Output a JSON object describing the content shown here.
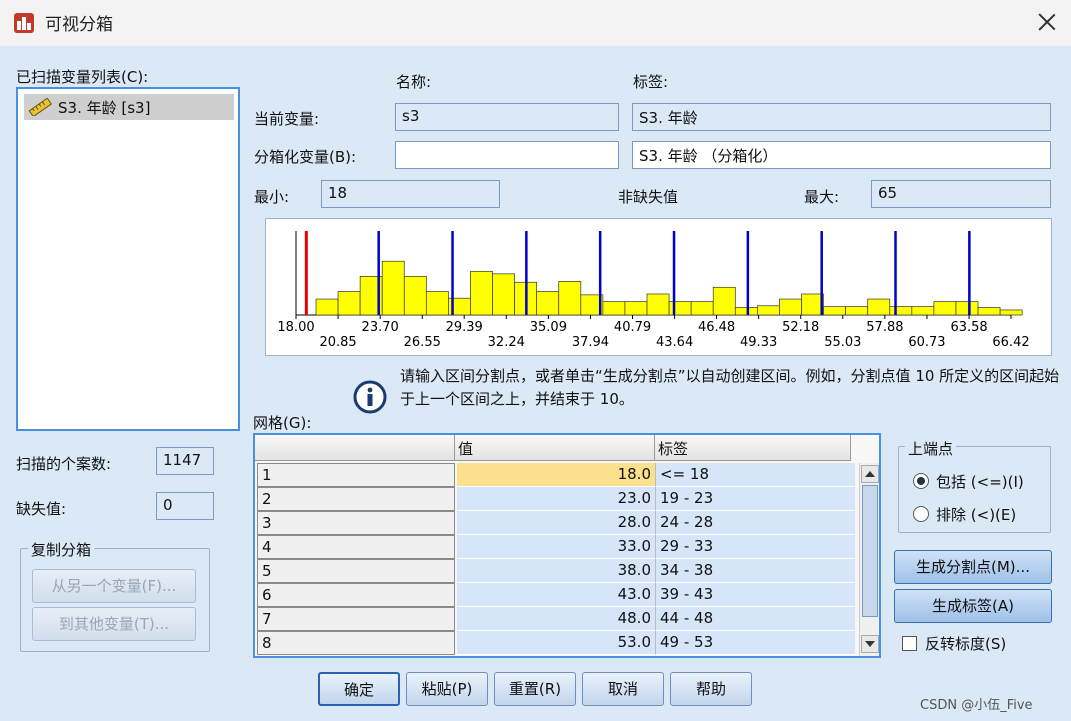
{
  "window": {
    "title": "可视分箱"
  },
  "var_list": {
    "label": "已扫描变量列表(C):",
    "items": [
      "S3. 年龄 [s3]"
    ]
  },
  "headers": {
    "name": "名称:",
    "label": "标签:"
  },
  "current_var": {
    "label": "当前变量:",
    "name": "s3",
    "var_label": "S3. 年龄"
  },
  "binned_var": {
    "label": "分箱化变量(B):",
    "name": "",
    "var_label": "S3. 年龄 （分箱化）"
  },
  "stats": {
    "min_label": "最小:",
    "min": "18",
    "nonmissing_label": "非缺失值",
    "max_label": "最大:",
    "max": "65"
  },
  "histogram": {
    "bars": [
      0.19,
      0.28,
      0.46,
      0.64,
      0.46,
      0.28,
      0.2,
      0.52,
      0.49,
      0.39,
      0.28,
      0.4,
      0.24,
      0.16,
      0.16,
      0.25,
      0.16,
      0.16,
      0.33,
      0.09,
      0.11,
      0.19,
      0.25,
      0.1,
      0.1,
      0.19,
      0.1,
      0.1,
      0.16,
      0.16,
      0.09,
      0.06
    ],
    "cutpoints": [
      23,
      28,
      33,
      38,
      43,
      48,
      53,
      58,
      63
    ],
    "ticks_top": [
      "18.00",
      "23.70",
      "29.39",
      "35.09",
      "40.79",
      "46.48",
      "52.18",
      "57.88",
      "63.58"
    ],
    "ticks_bottom": [
      "20.85",
      "26.55",
      "32.24",
      "37.94",
      "43.64",
      "49.33",
      "55.03",
      "60.73",
      "66.42"
    ],
    "marker_color": "#e60000",
    "cut_color": "#0000cc",
    "bar_color": "#ffff00"
  },
  "info": {
    "text": "请输入区间分割点，或者单击“生成分割点”以自动创建区间。例如，分割点值 10 所定义的区间起始于上一个区间之上，并结束于 10。"
  },
  "grid": {
    "label": "网格(G):",
    "col_value": "值",
    "col_label": "标签",
    "rows": [
      {
        "idx": "1",
        "value": "18.0",
        "label": "<= 18"
      },
      {
        "idx": "2",
        "value": "23.0",
        "label": "19 - 23"
      },
      {
        "idx": "3",
        "value": "28.0",
        "label": "24 - 28"
      },
      {
        "idx": "4",
        "value": "33.0",
        "label": "29 - 33"
      },
      {
        "idx": "5",
        "value": "38.0",
        "label": "34 - 38"
      },
      {
        "idx": "6",
        "value": "43.0",
        "label": "39 - 43"
      },
      {
        "idx": "7",
        "value": "48.0",
        "label": "44 - 48"
      },
      {
        "idx": "8",
        "value": "53.0",
        "label": "49 - 53"
      }
    ]
  },
  "scan": {
    "cases_label": "扫描的个案数:",
    "cases": "1147",
    "missing_label": "缺失值:",
    "missing": "0"
  },
  "copy_bins": {
    "title": "复制分箱",
    "from_btn": "从另一个变量(F)...",
    "to_btn": "到其他变量(T)..."
  },
  "upper": {
    "title": "上端点",
    "include": "包括 (<=)(I)",
    "exclude": "排除 (<)(E)"
  },
  "side_buttons": {
    "make_cuts": "生成分割点(M)...",
    "make_labels": "生成标签(A)",
    "reverse": "反转标度(S)"
  },
  "footer": {
    "ok": "确定",
    "paste": "粘贴(P)",
    "reset": "重置(R)",
    "cancel": "取消",
    "help": "帮助"
  },
  "watermark": "CSDN @小伍_Five"
}
